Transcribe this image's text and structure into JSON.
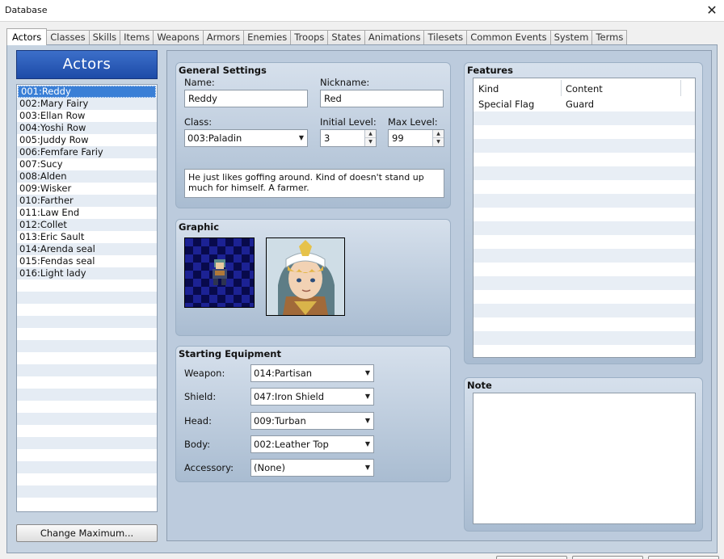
{
  "window": {
    "title": "Database",
    "close_glyph": "✕"
  },
  "tabs": [
    "Actors",
    "Classes",
    "Skills",
    "Items",
    "Weapons",
    "Armors",
    "Enemies",
    "Troops",
    "States",
    "Animations",
    "Tilesets",
    "Common Events",
    "System",
    "Terms"
  ],
  "actors_panel": {
    "header": "Actors",
    "selected_index": 0,
    "items": [
      "001:Reddy",
      "002:Mary Fairy",
      "003:Ellan Row",
      "004:Yoshi Row",
      "005:Juddy Row",
      "006:Femfare Fariy",
      "007:Sucy",
      "008:Alden",
      "009:Wisker",
      "010:Farther",
      "011:Law End",
      "012:Collet",
      "013:Eric Sault",
      "014:Arenda seal",
      "015:Fendas seal",
      "016:Light lady"
    ],
    "change_max_label": "Change Maximum..."
  },
  "general": {
    "title": "General Settings",
    "name_label": "Name:",
    "name_value": "Reddy",
    "nickname_label": "Nickname:",
    "nickname_value": "Red",
    "class_label": "Class:",
    "class_value": "003:Paladin",
    "initial_level_label": "Initial Level:",
    "initial_level_value": "3",
    "max_level_label": "Max Level:",
    "max_level_value": "99",
    "profile": "He just likes goffing around. Kind of doesn't stand up much for himself. A farmer."
  },
  "graphic": {
    "title": "Graphic"
  },
  "equipment": {
    "title": "Starting Equipment",
    "slots": [
      {
        "label": "Weapon:",
        "value": "014:Partisan"
      },
      {
        "label": "Shield:",
        "value": "047:Iron Shield"
      },
      {
        "label": "Head:",
        "value": "009:Turban"
      },
      {
        "label": "Body:",
        "value": "002:Leather Top"
      },
      {
        "label": "Accessory:",
        "value": "(None)"
      }
    ]
  },
  "features": {
    "title": "Features",
    "col_kind": "Kind",
    "col_content": "Content",
    "rows": [
      {
        "kind": "Special Flag",
        "content": "Guard"
      }
    ]
  },
  "note": {
    "title": "Note",
    "value": ""
  },
  "colors": {
    "selection": "#3a7fd6",
    "panel": "#c6d3e1",
    "header_blue": "#1d4ba8"
  }
}
